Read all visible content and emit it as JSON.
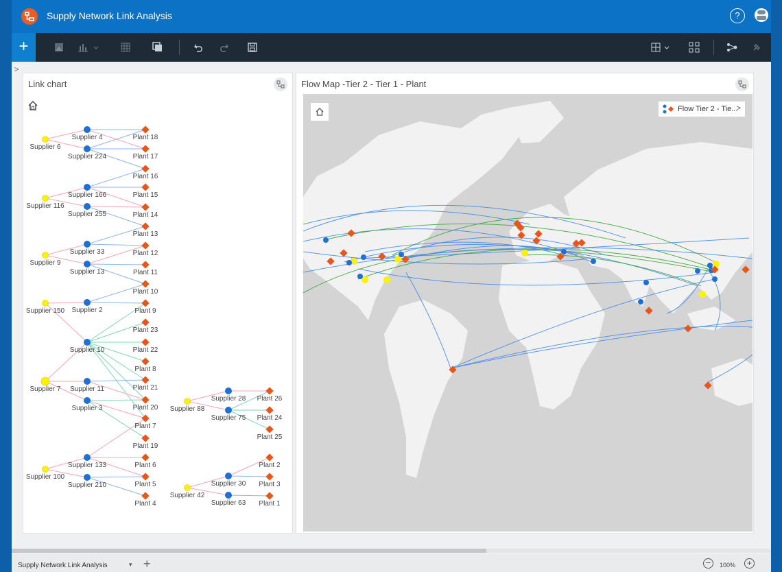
{
  "app": {
    "title": "Supply Network Link Analysis",
    "help_symbol": "?"
  },
  "toolbar": {
    "add_symbol": "+",
    "icons": [
      "image-icon",
      "bar-chart-icon",
      "table-icon",
      "duplicate-icon",
      "undo-icon",
      "redo-icon",
      "save-icon",
      "layout-icon",
      "qr-grid-icon",
      "link-analysis-icon",
      "pin-icon"
    ]
  },
  "side_toggle": ">",
  "link_chart": {
    "title": "Link chart",
    "supplier_tier2_color": "#fff200",
    "supplier_tier1_color": "#1f6fd6",
    "plant_color": "#e8561c",
    "nodes": {
      "Supplier 6": "Supplier 6",
      "Supplier 4": "Supplier 4",
      "Supplier 224": "Supplier 224",
      "Supplier 116": "Supplier 116",
      "Supplier 166": "Supplier 166",
      "Supplier 255": "Supplier 255",
      "Supplier 9": "Supplier 9",
      "Supplier 33": "Supplier 33",
      "Supplier 13": "Supplier 13",
      "Supplier 150": "Supplier 150",
      "Supplier 2": "Supplier 2",
      "Supplier 10": "Supplier 10",
      "Supplier 7": "Supplier 7",
      "Supplier 11": "Supplier 11",
      "Supplier 3": "Supplier 3",
      "Supplier 100": "Supplier 100",
      "Supplier 133": "Supplier 133",
      "Supplier 210": "Supplier 210",
      "Supplier 88": "Supplier 88",
      "Supplier 28": "Supplier 28",
      "Supplier 75": "Supplier 75",
      "Supplier 42": "Supplier 42",
      "Supplier 30": "Supplier 30",
      "Supplier 63": "Supplier 63",
      "Plant 18": "Plant 18",
      "Plant 17": "Plant 17",
      "Plant 16": "Plant 16",
      "Plant 15": "Plant 15",
      "Plant 14": "Plant 14",
      "Plant 13": "Plant 13",
      "Plant 12": "Plant 12",
      "Plant 11": "Plant 11",
      "Plant 10": "Plant 10",
      "Plant 9": "Plant 9",
      "Plant 23": "Plant 23",
      "Plant 22": "Plant 22",
      "Plant 8": "Plant 8",
      "Plant 21": "Plant 21",
      "Plant 20": "Plant 20",
      "Plant 7": "Plant 7",
      "Plant 19": "Plant 19",
      "Plant 6": "Plant 6",
      "Plant 5": "Plant 5",
      "Plant 4": "Plant 4",
      "Plant 26": "Plant 26",
      "Plant 24": "Plant 24",
      "Plant 25": "Plant 25",
      "Plant 2": "Plant 2",
      "Plant 3": "Plant 3",
      "Plant 1": "Plant 1"
    }
  },
  "flow_map": {
    "title": "Flow Map -Tier 2 - Tier 1 - Plant",
    "legend_label": "Flow Tier 2 - Tie...",
    "legend_chevron": ">",
    "flow_color_tier1": "#3f87e6",
    "flow_color_tier2": "#3aa13a"
  },
  "footer": {
    "page_tab": "Supply Network Link Analysis",
    "page_caret": "▾",
    "add_page": "+",
    "zoom_out": "−",
    "zoom_level": "100%",
    "zoom_in": "+"
  }
}
